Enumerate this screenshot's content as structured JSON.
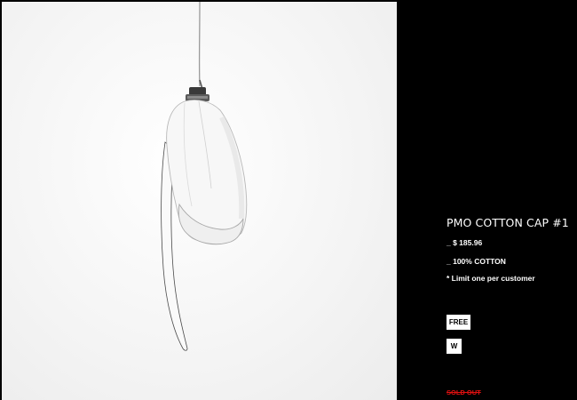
{
  "product": {
    "title": "PMO COTTON CAP #1",
    "price": "_ $ 185.96",
    "material": "_ 100% COTTON",
    "limit_note": "* Limit one per customer"
  },
  "options": {
    "size": "FREE",
    "color": "W"
  },
  "status": {
    "sold_out": "SOLD OUT"
  },
  "colors": {
    "page_background": "#000000",
    "photo_background": "#f4f4f4",
    "text": "#ffffff",
    "sold_out": "#e01010"
  }
}
